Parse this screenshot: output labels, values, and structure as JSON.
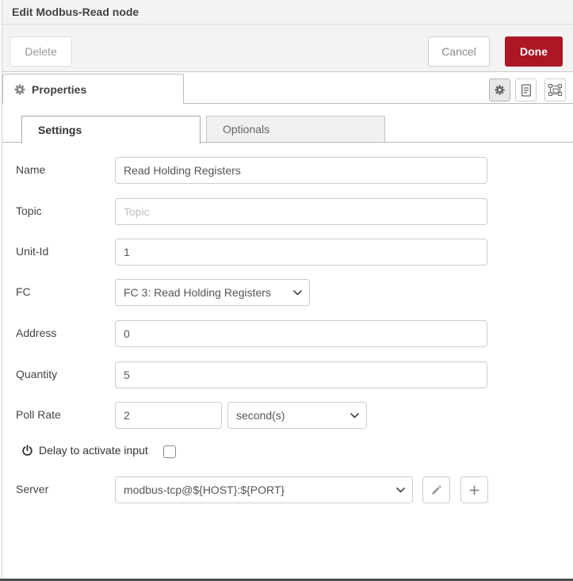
{
  "dialog": {
    "title": "Edit Modbus-Read node"
  },
  "toolbar": {
    "delete_label": "Delete",
    "cancel_label": "Cancel",
    "done_label": "Done"
  },
  "properties_tab": {
    "label": "Properties"
  },
  "editor_tabs": {
    "settings_label": "Settings",
    "optionals_label": "Optionals"
  },
  "form": {
    "name": {
      "label": "Name",
      "value": "Read Holding Registers"
    },
    "topic": {
      "label": "Topic",
      "placeholder": "Topic"
    },
    "unit_id": {
      "label": "Unit-Id",
      "value": "1"
    },
    "fc": {
      "label": "FC",
      "selected": "FC 3: Read Holding Registers"
    },
    "address": {
      "label": "Address",
      "value": "0"
    },
    "quantity": {
      "label": "Quantity",
      "value": "5"
    },
    "poll_rate": {
      "label": "Poll Rate",
      "value": "2",
      "unit_selected": "second(s)"
    },
    "delay": {
      "label": "Delay to activate input",
      "checked": false
    },
    "server": {
      "label": "Server",
      "selected": "modbus-tcp@${HOST}:${PORT}"
    }
  },
  "icons": {
    "properties": "gear-icon",
    "description": "document-icon",
    "appearance": "object-group-icon",
    "delay": "power-icon",
    "server_edit": "pencil-icon",
    "server_add": "plus-icon",
    "select_arrow": "chevron-down-icon"
  },
  "colors": {
    "accent_red": "#AD1625",
    "header_bg": "#f3f3f3",
    "border": "#cccccc",
    "active_icon_bg": "#e8e8e8"
  }
}
